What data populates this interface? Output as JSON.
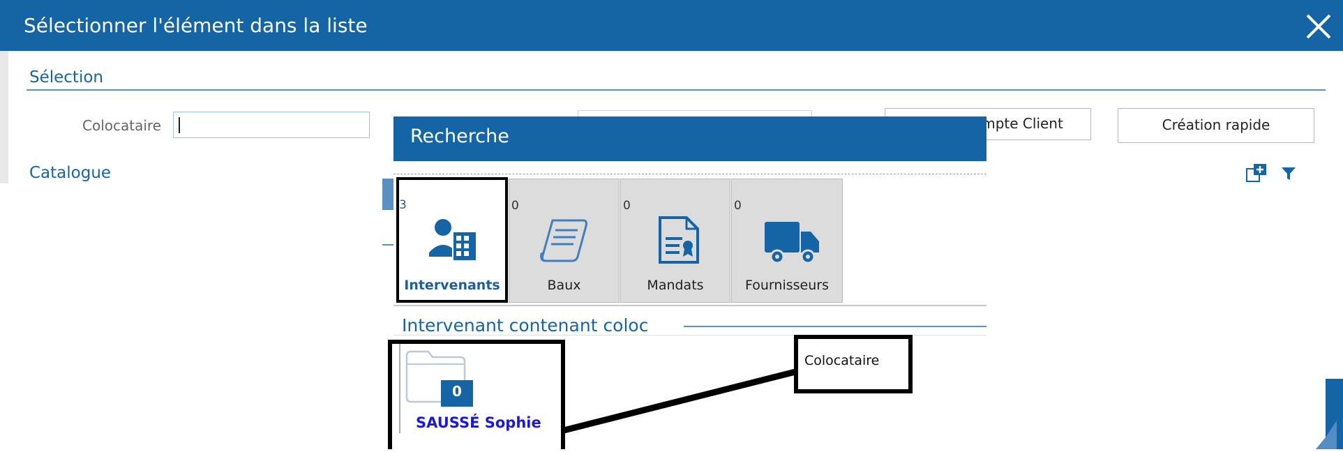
{
  "dialog": {
    "title": "Sélectionner l'élément dans la liste"
  },
  "selection": {
    "section_title": "Sélection",
    "colocataire_label": "Colocataire",
    "colocataire_value": "",
    "compte_client_label": "ompte Client",
    "creation_rapide_label": "Création rapide"
  },
  "catalogue": {
    "section_title": "Catalogue"
  },
  "recherche": {
    "title": "Recherche",
    "tabs": [
      {
        "count": "3",
        "label": "Intervenants",
        "icon": "intervenant-building-icon"
      },
      {
        "count": "0",
        "label": "Baux",
        "icon": "scroll-icon"
      },
      {
        "count": "0",
        "label": "Mandats",
        "icon": "certificate-icon"
      },
      {
        "count": "0",
        "label": "Fournisseurs",
        "icon": "truck-icon"
      }
    ],
    "results_title": "Intervenant contenant coloc",
    "result_card": {
      "badge": "0",
      "name": "SAUSSÉ Sophie"
    },
    "callout": "Colocataire"
  },
  "colors": {
    "brand_blue": "#1565a6",
    "link_blue": "#1a1ad6"
  }
}
